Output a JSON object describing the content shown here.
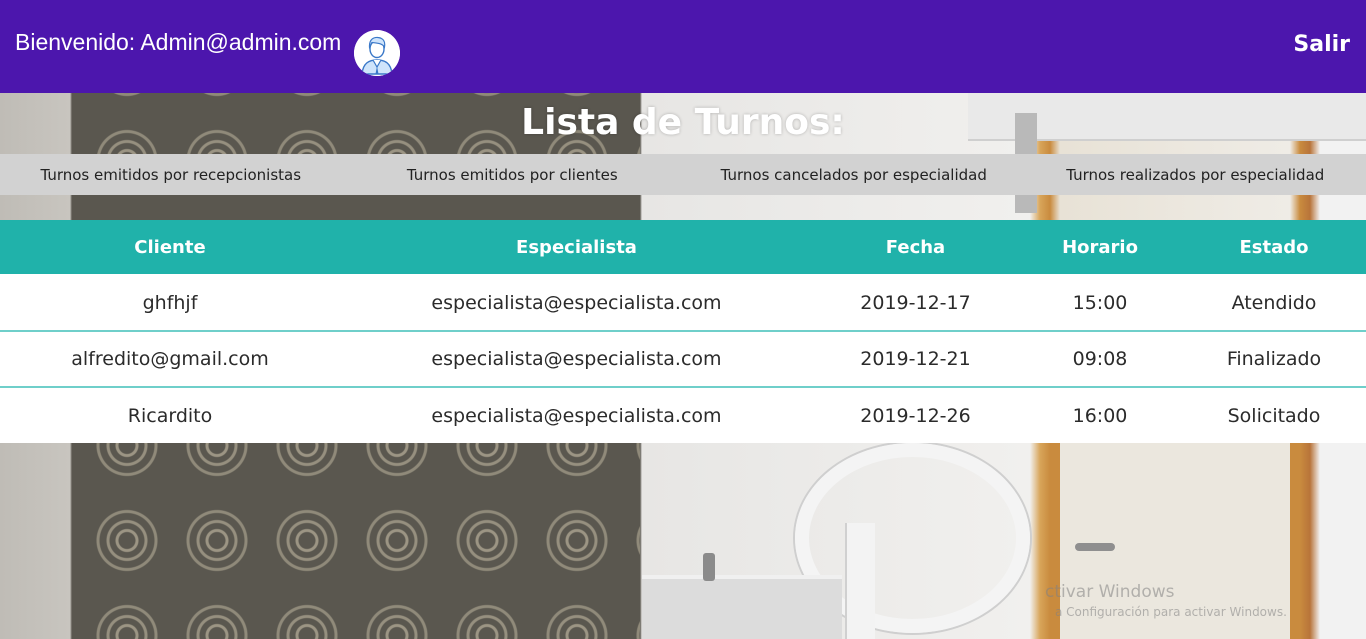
{
  "header": {
    "welcome_text": "Bienvenido: Admin@admin.com",
    "avatar_icon": "user-avatar-icon",
    "logout_label": "Salir",
    "background_color": "#4c16ad"
  },
  "page": {
    "title": "Lista de Turnos:"
  },
  "reports": {
    "items": [
      {
        "label": "Turnos emitidos por recepcionistas"
      },
      {
        "label": "Turnos emitidos por clientes"
      },
      {
        "label": "Turnos cancelados por especialidad"
      },
      {
        "label": "Turnos realizados por especialidad"
      }
    ]
  },
  "table": {
    "header_color": "#20b2aa",
    "columns": [
      "Cliente",
      "Especialista",
      "Fecha",
      "Horario",
      "Estado"
    ],
    "rows": [
      {
        "cliente": "ghfhjf",
        "especialista": "especialista@especialista.com",
        "fecha": "2019-12-17",
        "horario": "15:00",
        "estado": "Atendido"
      },
      {
        "cliente": "alfredito@gmail.com",
        "especialista": "especialista@especialista.com",
        "fecha": "2019-12-21",
        "horario": "09:08",
        "estado": "Finalizado"
      },
      {
        "cliente": "Ricardito",
        "especialista": "especialista@especialista.com",
        "fecha": "2019-12-26",
        "horario": "16:00",
        "estado": "Solicitado"
      }
    ]
  },
  "watermark": {
    "line1": "ctivar Windows",
    "line2": "a Configuración para activar Windows."
  }
}
